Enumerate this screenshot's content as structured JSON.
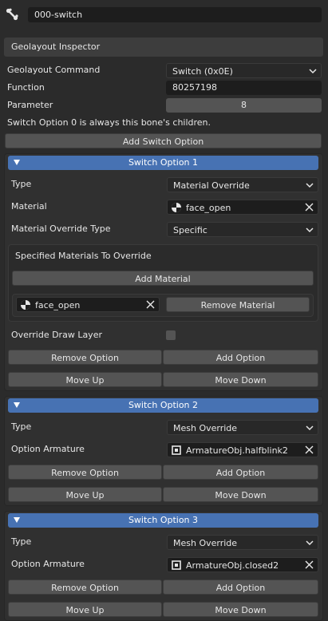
{
  "top": {
    "bone_name": "000-switch",
    "bone_icon": "bone-icon"
  },
  "inspector": {
    "title": "Geolayout Inspector",
    "command_label": "Geolayout Command",
    "command_value": "Switch (0x0E)",
    "function_label": "Function",
    "function_value": "80257198",
    "parameter_label": "Parameter",
    "parameter_value": "8",
    "note": "Switch Option 0 is always this bone's children.",
    "add_switch_option": "Add Switch Option"
  },
  "option1": {
    "title": "Switch Option 1",
    "type_label": "Type",
    "type_value": "Material Override",
    "material_label": "Material",
    "material_value": "face_open",
    "override_type_label": "Material Override Type",
    "override_type_value": "Specific",
    "specified_title": "Specified Materials To Override",
    "add_material": "Add Material",
    "specified_material": "face_open",
    "remove_material": "Remove Material",
    "draw_layer_label": "Override Draw Layer",
    "draw_layer_checked": false,
    "remove_option": "Remove Option",
    "add_option": "Add Option",
    "move_up": "Move Up",
    "move_down": "Move Down"
  },
  "option2": {
    "title": "Switch Option 2",
    "type_label": "Type",
    "type_value": "Mesh Override",
    "armature_label": "Option Armature",
    "armature_value": "ArmatureObj.halfblink2",
    "remove_option": "Remove Option",
    "add_option": "Add Option",
    "move_up": "Move Up",
    "move_down": "Move Down"
  },
  "option3": {
    "title": "Switch Option 3",
    "type_label": "Type",
    "type_value": "Mesh Override",
    "armature_label": "Option Armature",
    "armature_value": "ArmatureObj.closed2",
    "remove_option": "Remove Option",
    "add_option": "Add Option",
    "move_up": "Move Up",
    "move_down": "Move Down"
  },
  "colors": {
    "background": "#2b2b2b",
    "header_accent": "#4772b3",
    "button": "#545454",
    "field": "#1d1d1d"
  }
}
